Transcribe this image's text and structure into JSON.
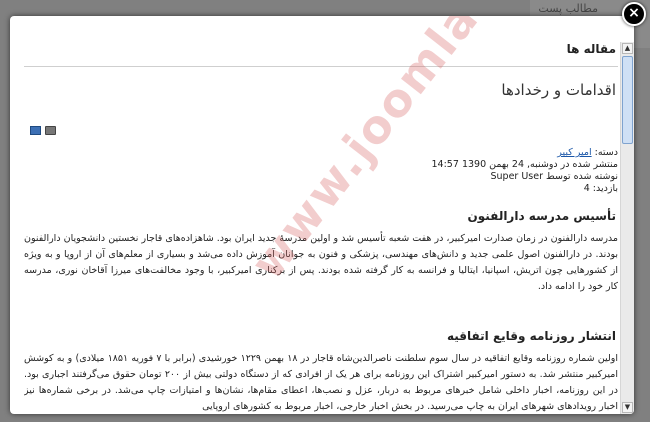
{
  "background": {
    "text": "مطالب پست"
  },
  "modal": {
    "close_label": "×",
    "section_title": "مقاله ها",
    "article_title": "اقدامات و رخدادها",
    "icons": [
      "email-icon",
      "print-icon"
    ],
    "meta": {
      "category_label": "دسته:",
      "category_value": "امیر کبیر",
      "published": "منتشر شده در دوشنبه, 24 بهمن 1390 14:57",
      "author": "نوشته شده توسط Super User",
      "hits_label": "بازدید:",
      "hits_value": "4"
    },
    "sections": [
      {
        "heading": "تأسیس مدرسه دارالفنون",
        "paragraph": "مدرسه دارالفنون در زمان صدارت امیرکبیر، در هفت شعبه تأسیس شد و اولین مدرسهٔ جدید ایران بود. شاهزاده‌های قاجار نخستین دانشجویان دارالفنون بودند. در دارالفنون اصول علمی جدید و دانش‌های مهندسی، پزشکی و فنون به جوانان آموزش داده می‌شد و بسیاری از معلم‌های آن از اروپا و به ویژه از کشورهایی چون اتریش، اسپانیا، ایتالیا و فرانسه به کار گرفته شده بودند. پس از برکناری امیرکبیر، با وجود مخالفت‌های میرزا آقاخان نوری، مدرسه کار خود را ادامه داد."
      },
      {
        "heading": "انتشار روزنامه وقایع اتفاقیه",
        "paragraph": "اولین شماره روزنامه وقایع اتفاقیه در سال سوم سلطنت ناصرالدین‌شاه قاجار در ۱۸ بهمن ۱۲۲۹ خورشیدی (برابر با ۷ فوریه ۱۸۵۱ میلادی) و به کوشش امیرکبیر منتشر شد. به دستور امیرکبیر اشتراک این روزنامه برای هر یک از افرادی که از دستگاه دولتی بیش از ۲۰۰ تومان حقوق می‌گرفتند اجباری بود. در این روزنامه، اخبار داخلی شامل خبرهای مربوط به دربار، عزل و نصب‌ها، اعطای مقام‌ها، نشان‌ها و امتیازات چاپ می‌شد. در برخی شماره‌ها نیز اخبار رویدادهای شهرهای ایران به چاپ می‌رسید. در بخش اخبار خارجی، اخبار مربوط به کشورهای اروپایی"
      }
    ],
    "watermark": "www.joomlafarsi.com"
  },
  "colors": {
    "link": "#1a56a8",
    "watermark": "#d76464",
    "overlay": "#808080"
  }
}
